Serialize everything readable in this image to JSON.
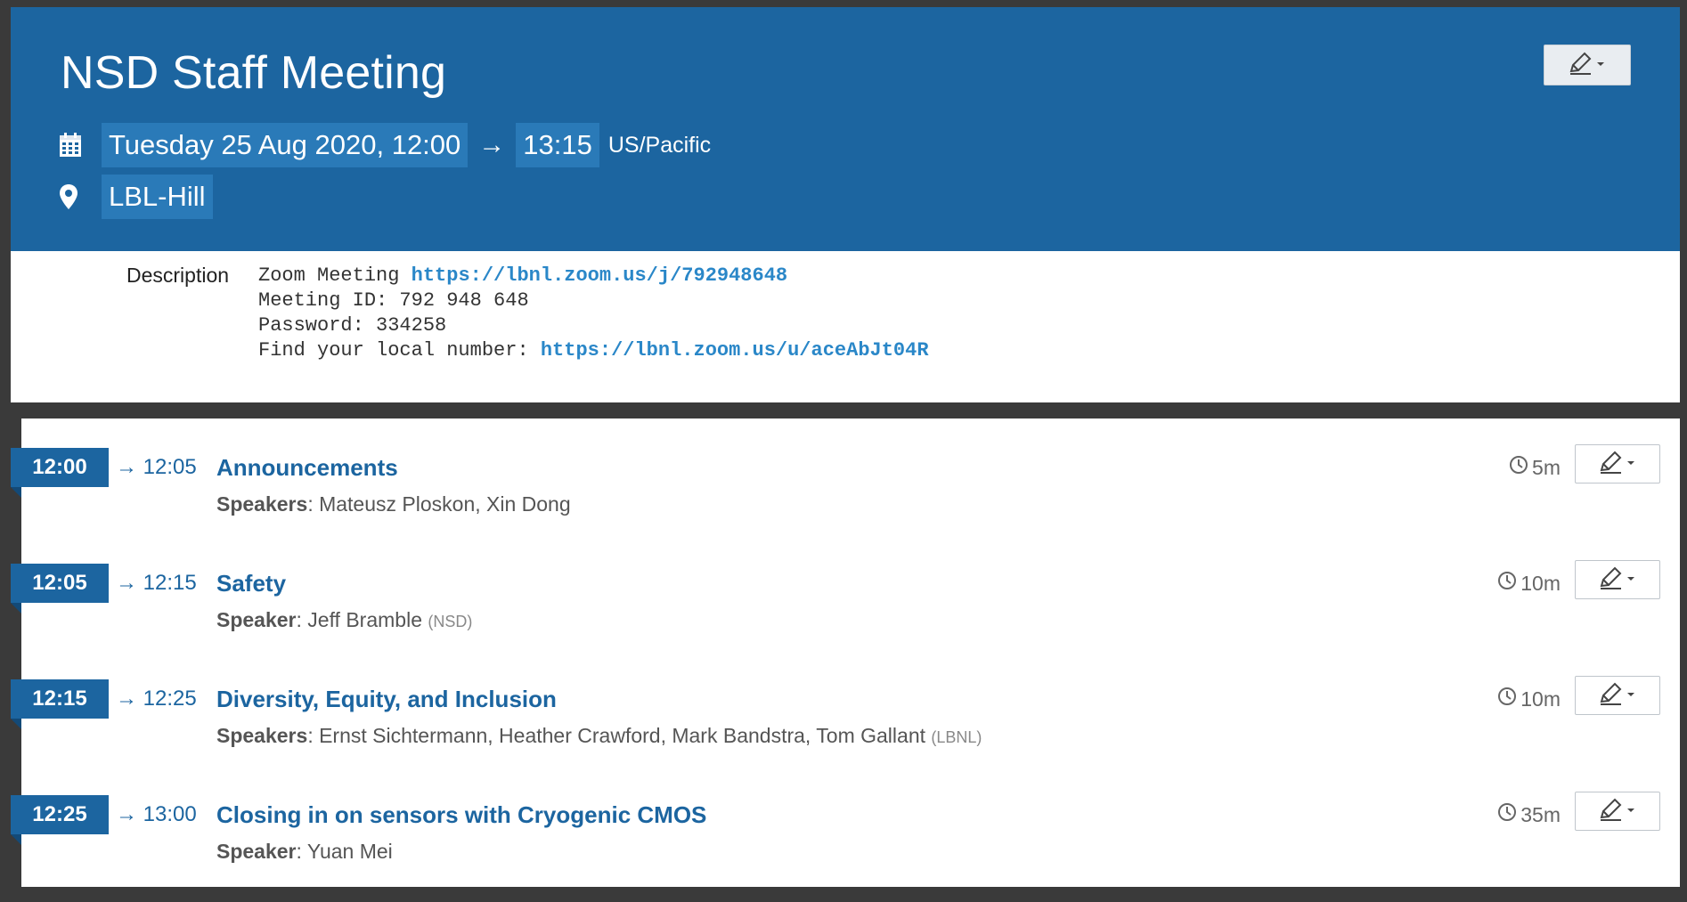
{
  "event": {
    "title": "NSD Staff Meeting",
    "start": "Tuesday 25 Aug 2020, 12:00",
    "arrow": "→",
    "end": "13:15",
    "timezone": "US/Pacific",
    "location": "LBL-Hill"
  },
  "description": {
    "label": "Description",
    "lines": [
      {
        "text": "Zoom Meeting ",
        "link": "https://lbnl.zoom.us/j/792948648"
      },
      {
        "text": "Meeting ID: 792 948 648",
        "link": ""
      },
      {
        "text": "Password: 334258",
        "link": ""
      },
      {
        "text": "Find your local number: ",
        "link": "https://lbnl.zoom.us/u/aceAbJt04R"
      }
    ]
  },
  "timetable": [
    {
      "start": "12:00",
      "end": "→ 12:05",
      "title": "Announcements",
      "speaker_label": "Speakers",
      "speakers": ": Mateusz Ploskon, Xin Dong",
      "affiliation": "",
      "duration": "5m"
    },
    {
      "start": "12:05",
      "end": "→ 12:15",
      "title": "Safety",
      "speaker_label": "Speaker",
      "speakers": ": Jeff Bramble ",
      "affiliation": "(NSD)",
      "duration": "10m"
    },
    {
      "start": "12:15",
      "end": "→ 12:25",
      "title": "Diversity, Equity, and Inclusion",
      "speaker_label": "Speakers",
      "speakers": ": Ernst Sichtermann, Heather Crawford, Mark Bandstra, Tom Gallant ",
      "affiliation": "(LBNL)",
      "duration": "10m"
    },
    {
      "start": "12:25",
      "end": "→ 13:00",
      "title": "Closing in on sensors with Cryogenic CMOS",
      "speaker_label": "Speaker",
      "speakers": ": Yuan Mei",
      "affiliation": "",
      "duration": "35m"
    }
  ],
  "icons": {
    "calendar": "calendar-icon",
    "location": "map-pin-icon",
    "edit": "pencil-icon",
    "clock": "clock-icon",
    "caret": "caret-down-icon"
  },
  "colors": {
    "header_bg": "#1c65a0",
    "highlight": "#2a7ab8",
    "link": "#2a87c8"
  }
}
